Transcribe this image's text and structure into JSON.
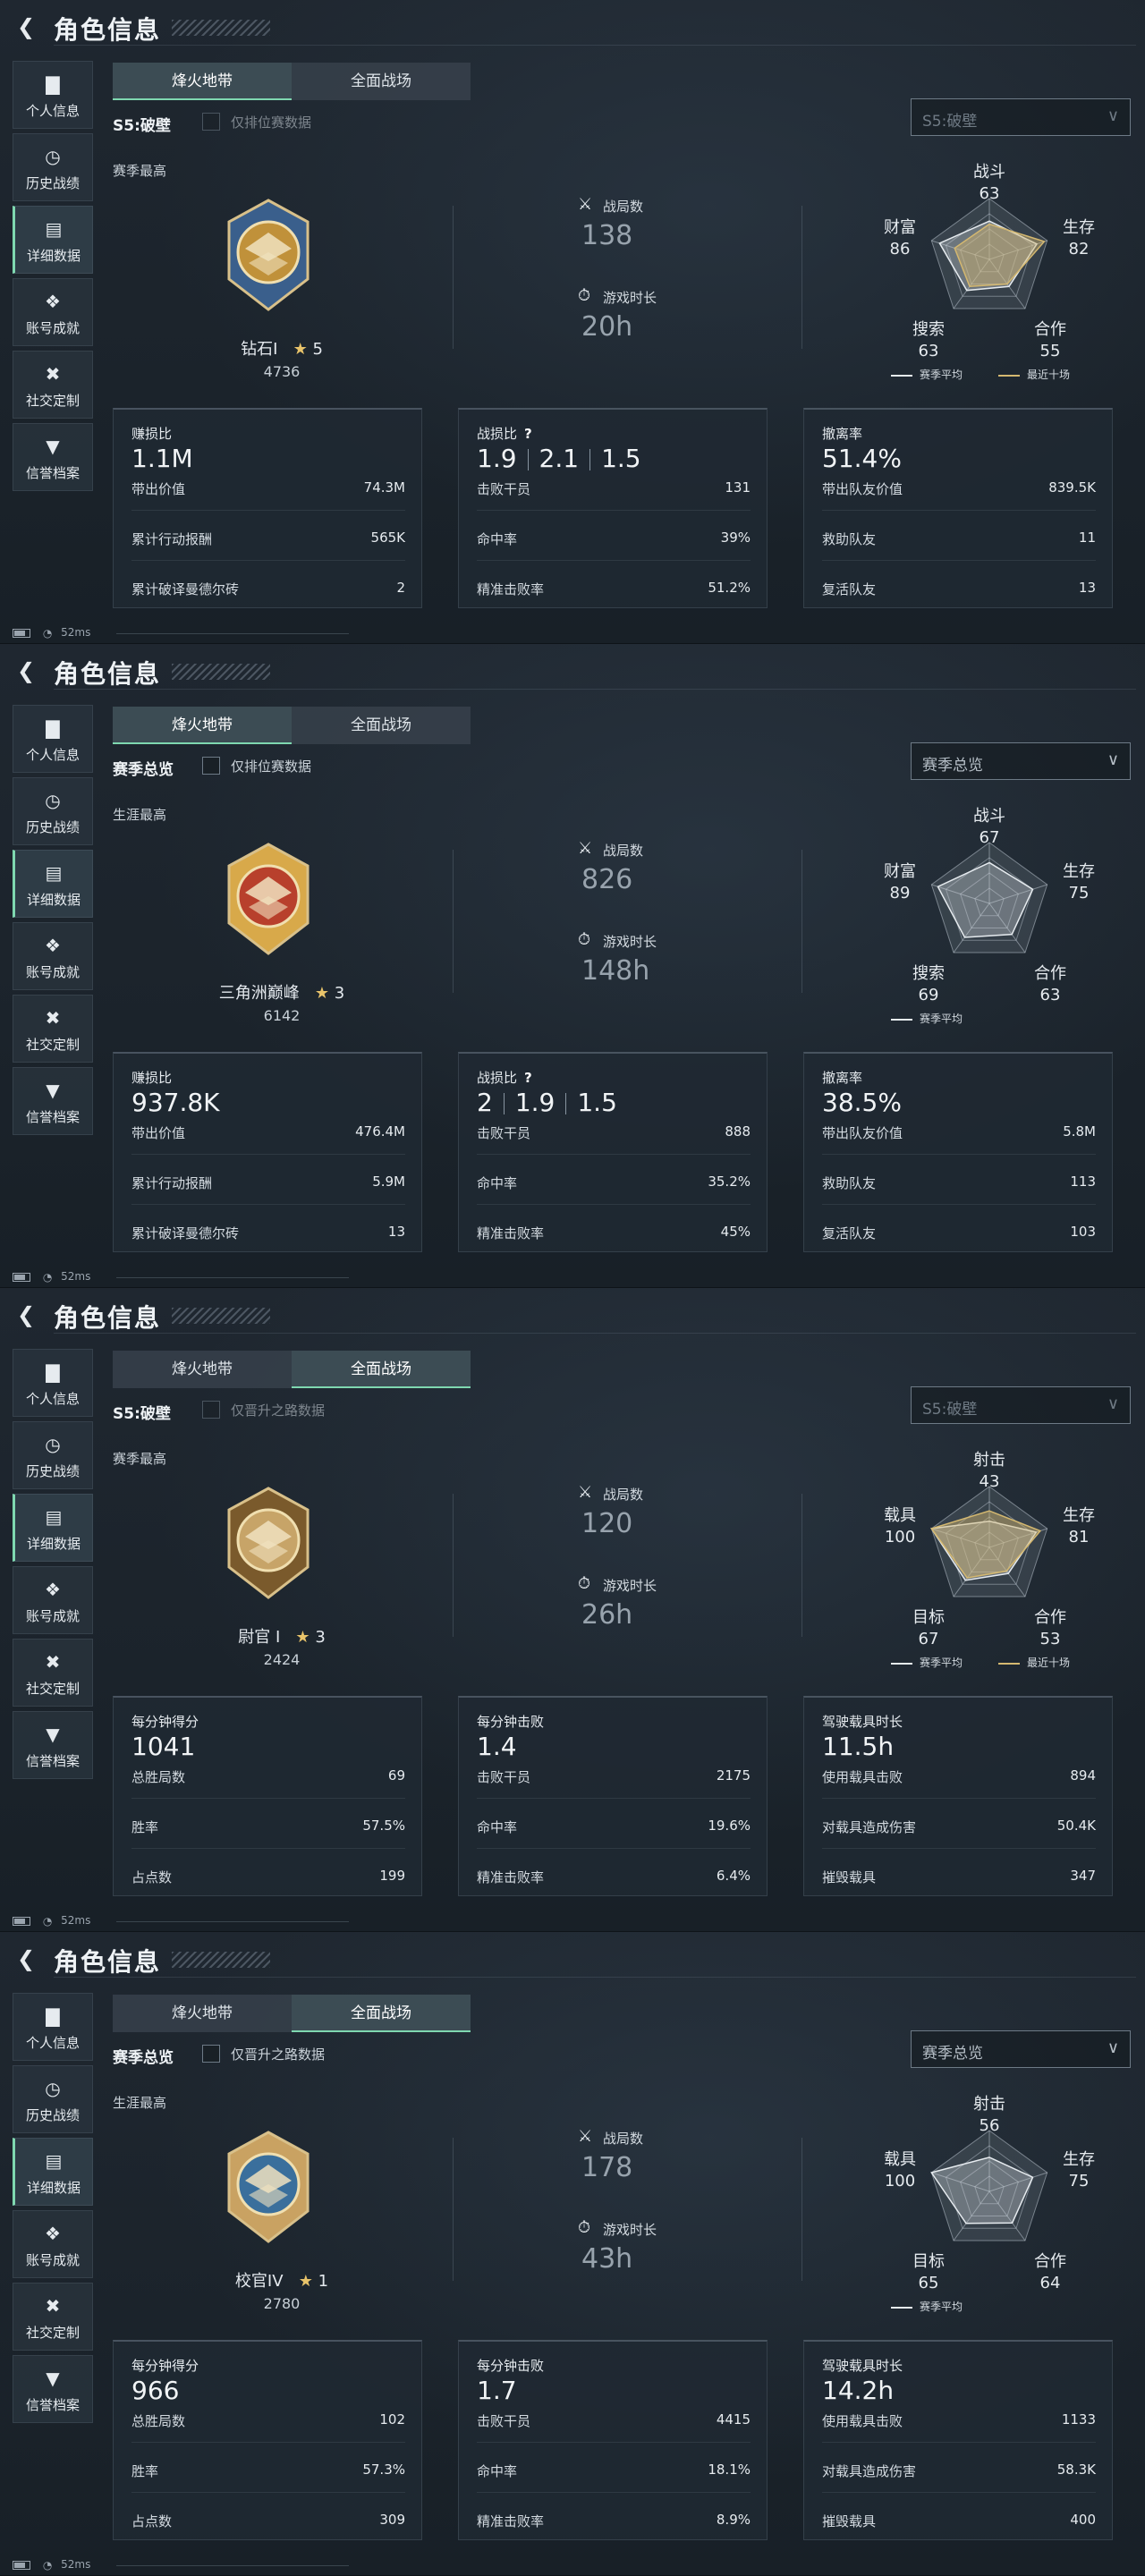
{
  "app": {
    "title": "角色信息",
    "sidebar": [
      "个人信息",
      "历史战绩",
      "详细数据",
      "账号成就",
      "社交定制",
      "信誉档案"
    ],
    "status_ping": "52ms"
  },
  "panels": [
    {
      "tabs": [
        "烽火地带",
        "全面战场"
      ],
      "active_tab": 0,
      "season_label": "S5:破壁",
      "checkbox_label": "仅排位赛数据",
      "select_value": "S5:破壁",
      "dim_select": true,
      "best_label": "赛季最高",
      "rank_name": "钻石I",
      "rank_stars": "5",
      "rank_score": "4736",
      "stat1_label": "战局数",
      "stat1_value": "138",
      "stat2_label": "游戏时长",
      "stat2_value": "20h",
      "radar": {
        "axes": [
          "战斗",
          "生存",
          "合作",
          "搜索",
          "财富"
        ],
        "values": [
          "63",
          "82",
          "55",
          "63",
          "86"
        ],
        "scores": [
          63,
          82,
          55,
          63,
          86
        ],
        "recent": [
          58,
          95,
          50,
          55,
          60
        ],
        "legend_avg": "赛季平均",
        "legend_recent": "最近十场",
        "show_recent": true
      },
      "cards": [
        {
          "title": "赚损比",
          "big": "1.1M",
          "ratio": null,
          "rows": [
            [
              "带出价值",
              "74.3M"
            ],
            [
              "累计行动报酬",
              "565K"
            ],
            [
              "累计破译曼德尔砖",
              "2"
            ]
          ]
        },
        {
          "title": "战损比",
          "big": null,
          "ratio": [
            "1.9",
            "2.1",
            "1.5"
          ],
          "rows": [
            [
              "击败干员",
              "131"
            ],
            [
              "命中率",
              "39%"
            ],
            [
              "精准击败率",
              "51.2%"
            ]
          ]
        },
        {
          "title": "撤离率",
          "big": "51.4%",
          "ratio": null,
          "rows": [
            [
              "带出队友价值",
              "839.5K"
            ],
            [
              "救助队友",
              "11"
            ],
            [
              "复活队友",
              "13"
            ]
          ]
        }
      ],
      "emblem_color": "#c0913a",
      "emblem_accent": "#3a5f8c"
    },
    {
      "tabs": [
        "烽火地带",
        "全面战场"
      ],
      "active_tab": 0,
      "season_label": "赛季总览",
      "checkbox_label": "仅排位赛数据",
      "select_value": "赛季总览",
      "dim_select": false,
      "best_label": "生涯最高",
      "rank_name": "三角洲巅峰",
      "rank_stars": "3",
      "rank_score": "6142",
      "stat1_label": "战局数",
      "stat1_value": "826",
      "stat2_label": "游戏时长",
      "stat2_value": "148h",
      "radar": {
        "axes": [
          "战斗",
          "生存",
          "合作",
          "搜索",
          "财富"
        ],
        "values": [
          "67",
          "75",
          "63",
          "69",
          "89"
        ],
        "scores": [
          67,
          75,
          63,
          69,
          89
        ],
        "recent": [],
        "legend_avg": "赛季平均",
        "legend_recent": "",
        "show_recent": false
      },
      "cards": [
        {
          "title": "赚损比",
          "big": "937.8K",
          "ratio": null,
          "rows": [
            [
              "带出价值",
              "476.4M"
            ],
            [
              "累计行动报酬",
              "5.9M"
            ],
            [
              "累计破译曼德尔砖",
              "13"
            ]
          ]
        },
        {
          "title": "战损比",
          "big": null,
          "ratio": [
            "2",
            "1.9",
            "1.5"
          ],
          "rows": [
            [
              "击败干员",
              "888"
            ],
            [
              "命中率",
              "35.2%"
            ],
            [
              "精准击败率",
              "45%"
            ]
          ]
        },
        {
          "title": "撤离率",
          "big": "38.5%",
          "ratio": null,
          "rows": [
            [
              "带出队友价值",
              "5.8M"
            ],
            [
              "救助队友",
              "113"
            ],
            [
              "复活队友",
              "103"
            ]
          ]
        }
      ],
      "emblem_color": "#b8402c",
      "emblem_accent": "#d8a94a"
    },
    {
      "tabs": [
        "烽火地带",
        "全面战场"
      ],
      "active_tab": 1,
      "season_label": "S5:破壁",
      "checkbox_label": "仅晋升之路数据",
      "select_value": "S5:破壁",
      "dim_select": true,
      "best_label": "赛季最高",
      "rank_name": "尉官 I",
      "rank_stars": "3",
      "rank_score": "2424",
      "stat1_label": "战局数",
      "stat1_value": "120",
      "stat2_label": "游戏时长",
      "stat2_value": "26h",
      "radar": {
        "axes": [
          "射击",
          "生存",
          "合作",
          "目标",
          "载具"
        ],
        "values": [
          "43",
          "81",
          "53",
          "67",
          "100"
        ],
        "scores": [
          43,
          81,
          53,
          67,
          100
        ],
        "recent": [
          60,
          88,
          48,
          62,
          100
        ],
        "legend_avg": "赛季平均",
        "legend_recent": "最近十场",
        "show_recent": true
      },
      "cards": [
        {
          "title": "每分钟得分",
          "big": "1041",
          "ratio": null,
          "rows": [
            [
              "总胜局数",
              "69"
            ],
            [
              "胜率",
              "57.5%"
            ],
            [
              "占点数",
              "199"
            ]
          ]
        },
        {
          "title": "每分钟击败",
          "big": "1.4",
          "ratio": null,
          "rows": [
            [
              "击败干员",
              "2175"
            ],
            [
              "命中率",
              "19.6%"
            ],
            [
              "精准击败率",
              "6.4%"
            ]
          ]
        },
        {
          "title": "驾驶载具时长",
          "big": "11.5h",
          "ratio": null,
          "rows": [
            [
              "使用载具击败",
              "894"
            ],
            [
              "对载具造成伤害",
              "50.4K"
            ],
            [
              "摧毁载具",
              "347"
            ]
          ]
        }
      ],
      "emblem_color": "#c7a468",
      "emblem_accent": "#7a5a2c"
    },
    {
      "tabs": [
        "烽火地带",
        "全面战场"
      ],
      "active_tab": 1,
      "season_label": "赛季总览",
      "checkbox_label": "仅晋升之路数据",
      "select_value": "赛季总览",
      "dim_select": false,
      "best_label": "生涯最高",
      "rank_name": "校官IV",
      "rank_stars": "1",
      "rank_score": "2780",
      "stat1_label": "战局数",
      "stat1_value": "178",
      "stat2_label": "游戏时长",
      "stat2_value": "43h",
      "radar": {
        "axes": [
          "射击",
          "生存",
          "合作",
          "目标",
          "载具"
        ],
        "values": [
          "56",
          "75",
          "64",
          "65",
          "100"
        ],
        "scores": [
          56,
          75,
          64,
          65,
          100
        ],
        "recent": [],
        "legend_avg": "赛季平均",
        "legend_recent": "",
        "show_recent": false
      },
      "cards": [
        {
          "title": "每分钟得分",
          "big": "966",
          "ratio": null,
          "rows": [
            [
              "总胜局数",
              "102"
            ],
            [
              "胜率",
              "57.3%"
            ],
            [
              "占点数",
              "309"
            ]
          ]
        },
        {
          "title": "每分钟击败",
          "big": "1.7",
          "ratio": null,
          "rows": [
            [
              "击败干员",
              "4415"
            ],
            [
              "命中率",
              "18.1%"
            ],
            [
              "精准击败率",
              "8.9%"
            ]
          ]
        },
        {
          "title": "驾驶载具时长",
          "big": "14.2h",
          "ratio": null,
          "rows": [
            [
              "使用载具击败",
              "1133"
            ],
            [
              "对载具造成伤害",
              "58.3K"
            ],
            [
              "摧毁载具",
              "400"
            ]
          ]
        }
      ],
      "emblem_color": "#3a6f9c",
      "emblem_accent": "#c9a262"
    }
  ]
}
